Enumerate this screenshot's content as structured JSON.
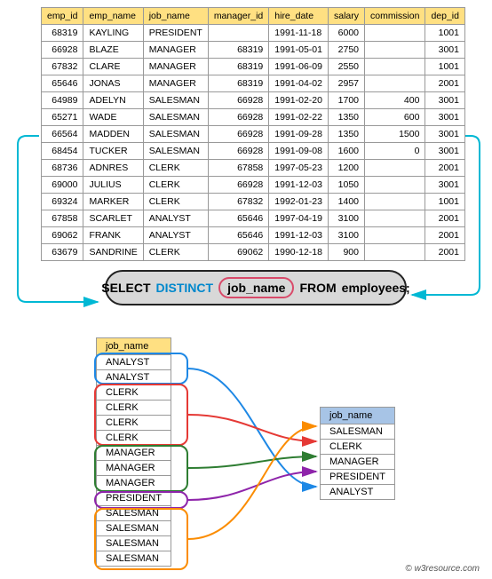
{
  "employees_table": {
    "headers": [
      "emp_id",
      "emp_name",
      "job_name",
      "manager_id",
      "hire_date",
      "salary",
      "commission",
      "dep_id"
    ],
    "rows": [
      {
        "emp_id": "68319",
        "emp_name": "KAYLING",
        "job_name": "PRESIDENT",
        "manager_id": "",
        "hire_date": "1991-11-18",
        "salary": "6000",
        "commission": "",
        "dep_id": "1001"
      },
      {
        "emp_id": "66928",
        "emp_name": "BLAZE",
        "job_name": "MANAGER",
        "manager_id": "68319",
        "hire_date": "1991-05-01",
        "salary": "2750",
        "commission": "",
        "dep_id": "3001"
      },
      {
        "emp_id": "67832",
        "emp_name": "CLARE",
        "job_name": "MANAGER",
        "manager_id": "68319",
        "hire_date": "1991-06-09",
        "salary": "2550",
        "commission": "",
        "dep_id": "1001"
      },
      {
        "emp_id": "65646",
        "emp_name": "JONAS",
        "job_name": "MANAGER",
        "manager_id": "68319",
        "hire_date": "1991-04-02",
        "salary": "2957",
        "commission": "",
        "dep_id": "2001"
      },
      {
        "emp_id": "64989",
        "emp_name": "ADELYN",
        "job_name": "SALESMAN",
        "manager_id": "66928",
        "hire_date": "1991-02-20",
        "salary": "1700",
        "commission": "400",
        "dep_id": "3001"
      },
      {
        "emp_id": "65271",
        "emp_name": "WADE",
        "job_name": "SALESMAN",
        "manager_id": "66928",
        "hire_date": "1991-02-22",
        "salary": "1350",
        "commission": "600",
        "dep_id": "3001"
      },
      {
        "emp_id": "66564",
        "emp_name": "MADDEN",
        "job_name": "SALESMAN",
        "manager_id": "66928",
        "hire_date": "1991-09-28",
        "salary": "1350",
        "commission": "1500",
        "dep_id": "3001"
      },
      {
        "emp_id": "68454",
        "emp_name": "TUCKER",
        "job_name": "SALESMAN",
        "manager_id": "66928",
        "hire_date": "1991-09-08",
        "salary": "1600",
        "commission": "0",
        "dep_id": "3001"
      },
      {
        "emp_id": "68736",
        "emp_name": "ADNRES",
        "job_name": "CLERK",
        "manager_id": "67858",
        "hire_date": "1997-05-23",
        "salary": "1200",
        "commission": "",
        "dep_id": "2001"
      },
      {
        "emp_id": "69000",
        "emp_name": "JULIUS",
        "job_name": "CLERK",
        "manager_id": "66928",
        "hire_date": "1991-12-03",
        "salary": "1050",
        "commission": "",
        "dep_id": "3001"
      },
      {
        "emp_id": "69324",
        "emp_name": "MARKER",
        "job_name": "CLERK",
        "manager_id": "67832",
        "hire_date": "1992-01-23",
        "salary": "1400",
        "commission": "",
        "dep_id": "1001"
      },
      {
        "emp_id": "67858",
        "emp_name": "SCARLET",
        "job_name": "ANALYST",
        "manager_id": "65646",
        "hire_date": "1997-04-19",
        "salary": "3100",
        "commission": "",
        "dep_id": "2001"
      },
      {
        "emp_id": "69062",
        "emp_name": "FRANK",
        "job_name": "ANALYST",
        "manager_id": "65646",
        "hire_date": "1991-12-03",
        "salary": "3100",
        "commission": "",
        "dep_id": "2001"
      },
      {
        "emp_id": "63679",
        "emp_name": "SANDRINE",
        "job_name": "CLERK",
        "manager_id": "69062",
        "hire_date": "1990-12-18",
        "salary": "900",
        "commission": "",
        "dep_id": "2001"
      }
    ]
  },
  "sql": {
    "select": "SELECT",
    "distinct": "DISTINCT",
    "job_name": "job_name",
    "from": "FROM",
    "employees": "employees;"
  },
  "left_list": {
    "header": "job_name",
    "rows": [
      "ANALYST",
      "ANALYST",
      "CLERK",
      "CLERK",
      "CLERK",
      "CLERK",
      "MANAGER",
      "MANAGER",
      "MANAGER",
      "PRESIDENT",
      "SALESMAN",
      "SALESMAN",
      "SALESMAN",
      "SALESMAN"
    ]
  },
  "result": {
    "header": "job_name",
    "rows": [
      "SALESMAN",
      "CLERK",
      "MANAGER",
      "PRESIDENT",
      "ANALYST"
    ]
  },
  "footer": {
    "copy": "©",
    "site": "w3resource.com"
  },
  "colors": {
    "blue": "#1e88e5",
    "red": "#e53935",
    "green": "#2e7d32",
    "purple": "#8e24aa",
    "orange": "#fb8c00",
    "cyan_arrow": "#00b8d4"
  }
}
